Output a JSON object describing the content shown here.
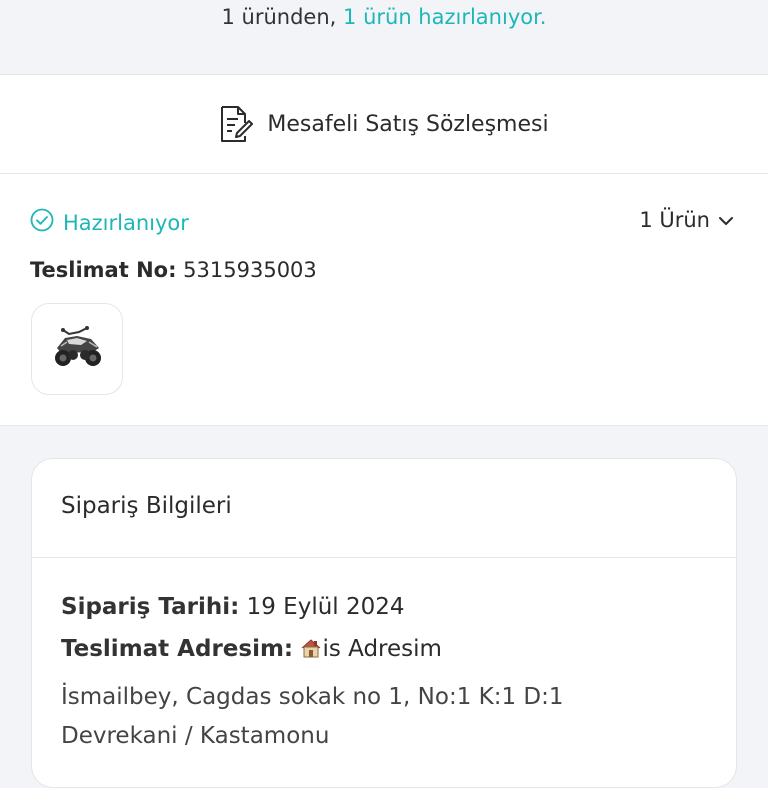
{
  "status_banner": {
    "prefix": "1 üründen,",
    "highlight": "1 ürün hazırlanıyor."
  },
  "contract": {
    "label": "Mesafeli Satış Sözleşmesi",
    "icon": "document-edit-icon"
  },
  "shipment": {
    "status_label": "Hazırlanıyor",
    "status_icon": "check-circle-icon",
    "item_count_label": "1 Ürün",
    "expand_icon": "chevron-down-icon",
    "delivery_no_key": "Teslimat No:",
    "delivery_no_value": "5315935003",
    "product_image": "atv-quad-bike-image"
  },
  "order_info": {
    "title": "Sipariş Bilgileri",
    "date_key": "Sipariş Tarihi:",
    "date_value": "19 Eylül 2024",
    "address_key": "Teslimat Adresim:",
    "address_name": "is Adresim",
    "address_icon": "house-icon",
    "address_line1": "İsmailbey, Cagdas sokak no 1, No:1 K:1 D:1",
    "address_line2": "Devrekani / Kastamonu"
  },
  "colors": {
    "accent": "#1eb7b7",
    "background": "#f2f4f8",
    "card": "#ffffff",
    "border": "#e3e6ea"
  }
}
